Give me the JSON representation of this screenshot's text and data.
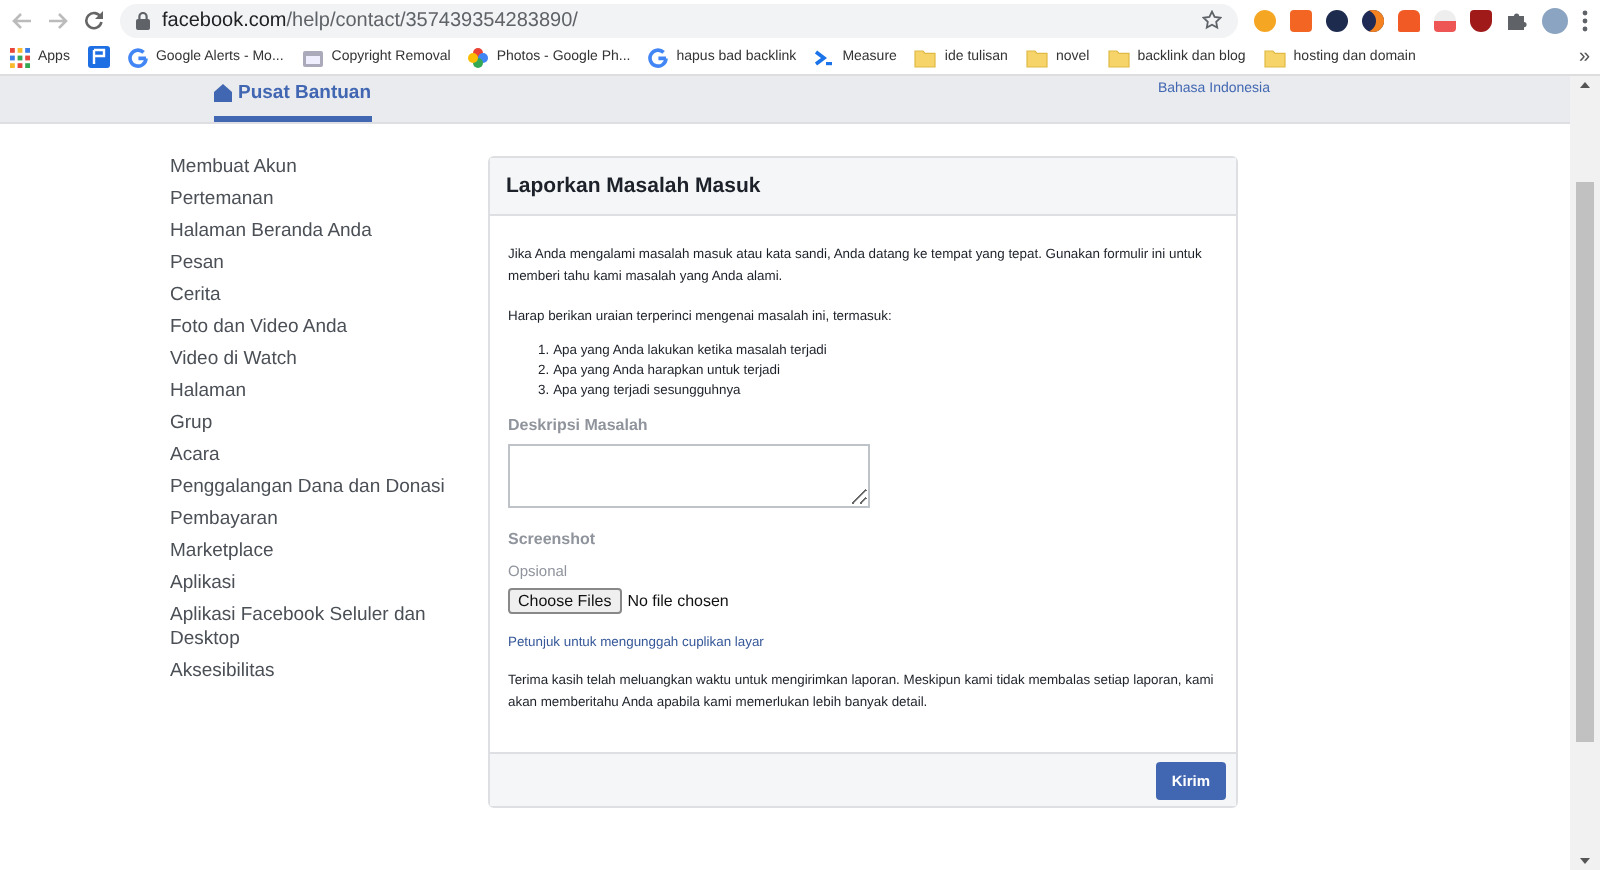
{
  "browser": {
    "url_host": "facebook.com",
    "url_path": "/help/contact/357439354283890/"
  },
  "bookmarks": [
    {
      "label": "Apps",
      "kind": "apps"
    },
    {
      "kind": "flag"
    },
    {
      "label": "Google Alerts - Mo...",
      "kind": "google"
    },
    {
      "label": "Copyright Removal",
      "kind": "calendar"
    },
    {
      "label": "Photos - Google Ph...",
      "kind": "photos"
    },
    {
      "label": "hapus bad backlink",
      "kind": "google"
    },
    {
      "label": "Measure",
      "kind": "measure"
    },
    {
      "label": "ide tulisan",
      "kind": "folder"
    },
    {
      "label": "novel",
      "kind": "folder"
    },
    {
      "label": "backlink dan blog",
      "kind": "folder"
    },
    {
      "label": "hosting dan domain",
      "kind": "folder"
    },
    {
      "label": "»",
      "kind": "more"
    }
  ],
  "header": {
    "tab": {
      "label": "Pusat Bantuan",
      "selected": true
    },
    "language": "Bahasa Indonesia"
  },
  "sidebar": {
    "items": [
      "Membuat Akun",
      "Pertemanan",
      "Halaman Beranda Anda",
      "Pesan",
      "Cerita",
      "Foto dan Video Anda",
      "Video di Watch",
      "Halaman",
      "Grup",
      "Acara",
      "Penggalangan Dana dan Donasi",
      "Pembayaran",
      "Marketplace",
      "Aplikasi",
      "Aplikasi Facebook Seluler dan Desktop",
      "Aksesibilitas"
    ]
  },
  "form": {
    "title": "Laporkan Masalah Masuk",
    "intro": "Jika Anda mengalami masalah masuk atau kata sandi, Anda datang ke tempat yang tepat. Gunakan formulir ini untuk memberi tahu kami masalah yang Anda alami.",
    "details_heading": "Harap berikan uraian terperinci mengenai masalah ini, termasuk:",
    "steps": [
      {
        "number": "1.",
        "text": "Apa yang Anda lakukan ketika masalah terjadi"
      },
      {
        "number": "2.",
        "text": "Apa yang Anda harapkan untuk terjadi"
      },
      {
        "number": "3.",
        "text": "Apa yang terjadi sesungguhnya"
      }
    ],
    "description_label": "Deskripsi Masalah",
    "screenshot_label": "Screenshot",
    "optional_label": "Opsional",
    "file_button": "Choose Files",
    "file_status": "No file chosen",
    "help_link": "Petunjuk untuk mengunggah cuplikan layar",
    "thanks": "Terima kasih telah meluangkan waktu untuk mengirimkan laporan. Meskipun kami tidak membalas setiap laporan, kami akan memberitahu Anda apabila kami memerlukan lebih banyak detail.",
    "submit": "Kirim"
  }
}
